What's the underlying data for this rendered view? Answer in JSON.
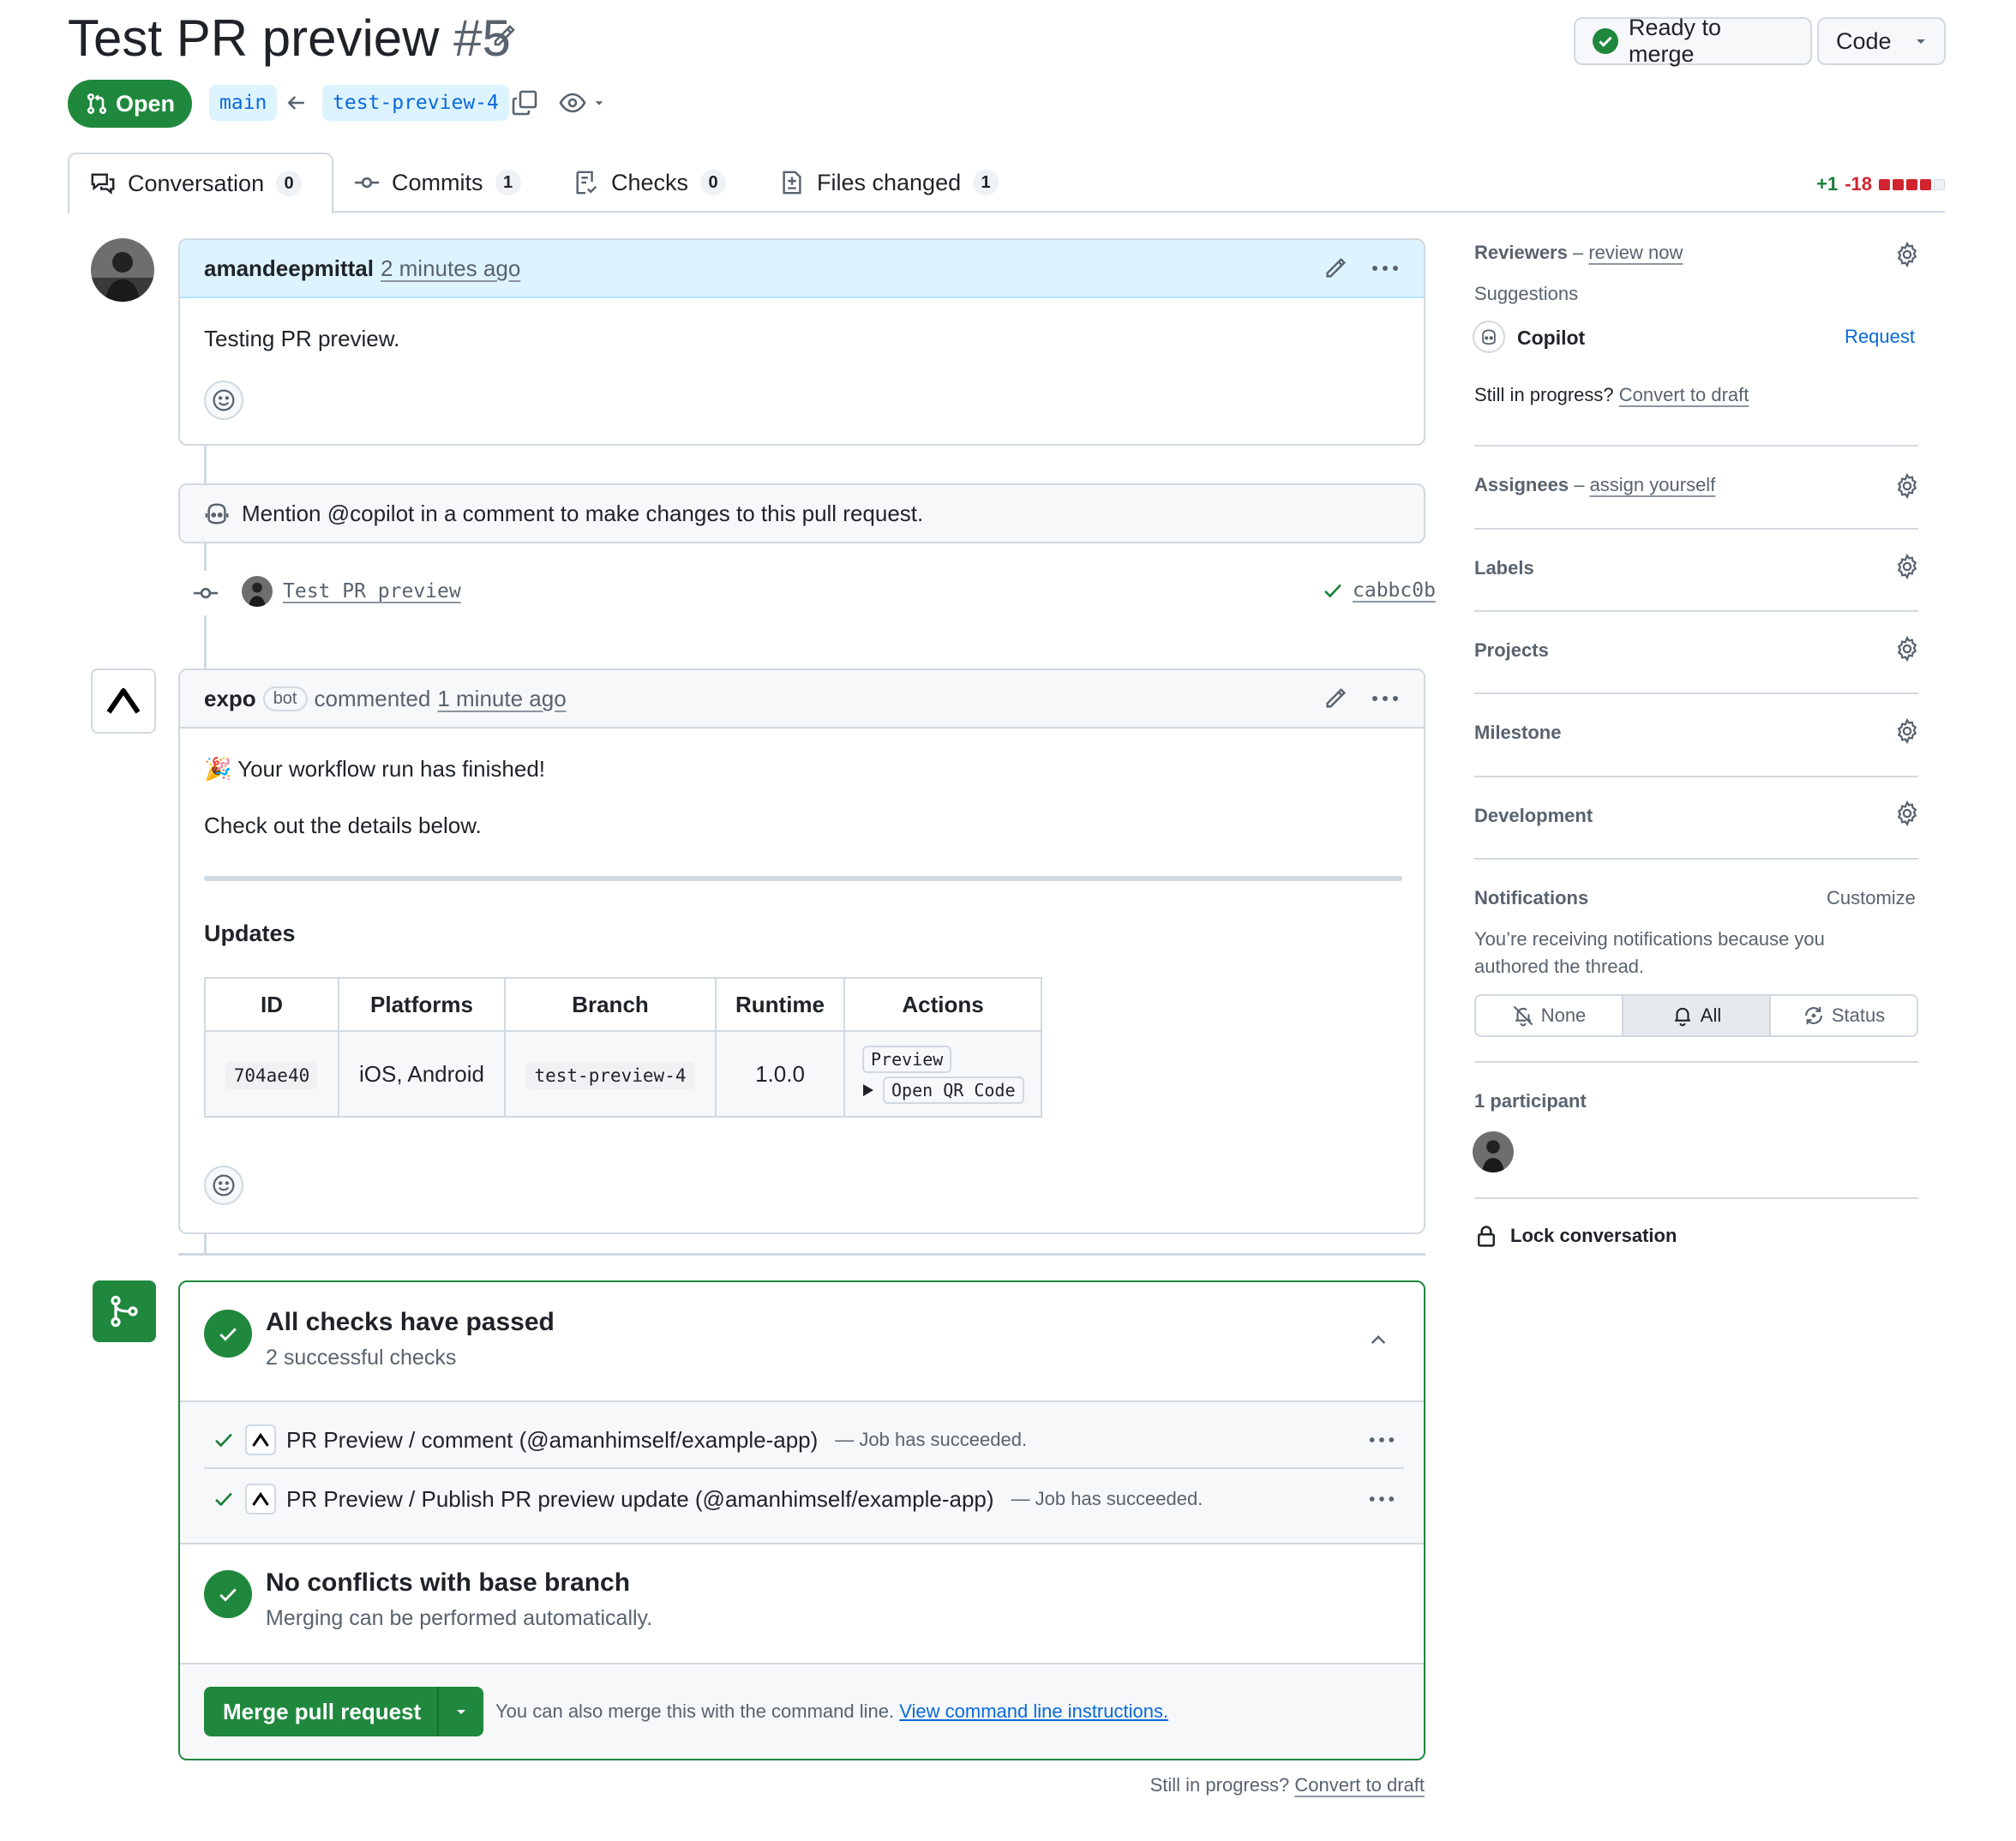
{
  "header": {
    "title": "Test PR preview",
    "number": "#5",
    "state": "Open",
    "base_branch": "main",
    "head_branch": "test-preview-4",
    "ready_label": "Ready to merge",
    "code_label": "Code"
  },
  "tabs": [
    {
      "label": "Conversation",
      "count": "0"
    },
    {
      "label": "Commits",
      "count": "1"
    },
    {
      "label": "Checks",
      "count": "0"
    },
    {
      "label": "Files changed",
      "count": "1"
    }
  ],
  "diffstat": {
    "additions": "+1",
    "deletions": "-18"
  },
  "first_comment": {
    "author": "amandeepmittal",
    "time": "2 minutes ago",
    "body": "Testing PR preview."
  },
  "copilot_notice": "Mention @copilot in a comment to make changes to this pull request.",
  "commit": {
    "message": "Test PR preview",
    "sha": "cabbc0b"
  },
  "bot_comment": {
    "author": "expo",
    "badge": "bot",
    "verb": "commented",
    "time": "1 minute ago",
    "line1": "🎉 Your workflow run has finished!",
    "line2": "Check out the details below.",
    "updates_heading": "Updates",
    "table": {
      "headers": [
        "ID",
        "Platforms",
        "Branch",
        "Runtime",
        "Actions"
      ],
      "row": {
        "id": "704ae40",
        "platforms": "iOS, Android",
        "branch": "test-preview-4",
        "runtime": "1.0.0",
        "action_preview": "Preview",
        "action_qr": "Open QR Code"
      }
    }
  },
  "merge": {
    "checks_title": "All checks have passed",
    "checks_sub": "2 successful checks",
    "checks": [
      {
        "name": "PR Preview / comment (@amanhimself/example-app)",
        "status": "— Job has succeeded."
      },
      {
        "name": "PR Preview / Publish PR preview update (@amanhimself/example-app)",
        "status": "— Job has succeeded."
      }
    ],
    "conflicts_title": "No conflicts with base branch",
    "conflicts_sub": "Merging can be performed automatically.",
    "merge_button": "Merge pull request",
    "cli_text": "You can also merge this with the command line.",
    "cli_link": "View command line instructions.",
    "footer_prefix": "Still in progress?",
    "footer_link": "Convert to draft"
  },
  "sidebar": {
    "reviewers": "Reviewers",
    "reviewers_dash": "–",
    "review_now": "review now",
    "suggestions": "Suggestions",
    "copilot": "Copilot",
    "request": "Request",
    "still_prefix": "Still in progress?",
    "still_link": "Convert to draft",
    "assignees": "Assignees",
    "assignees_dash": "–",
    "assign_yourself": "assign yourself",
    "labels": "Labels",
    "projects": "Projects",
    "milestone": "Milestone",
    "development": "Development",
    "notifications": "Notifications",
    "customize": "Customize",
    "notif_text": "You’re receiving notifications because you authored the thread.",
    "notif_options": [
      "None",
      "All",
      "Status"
    ],
    "participants": "1 participant",
    "lock": "Lock conversation"
  },
  "colors": {
    "green": "#1f883d",
    "blue": "#0969da",
    "border": "#d1d9e0",
    "header_blue_bg": "#ddf4ff",
    "red": "#d1242f"
  }
}
